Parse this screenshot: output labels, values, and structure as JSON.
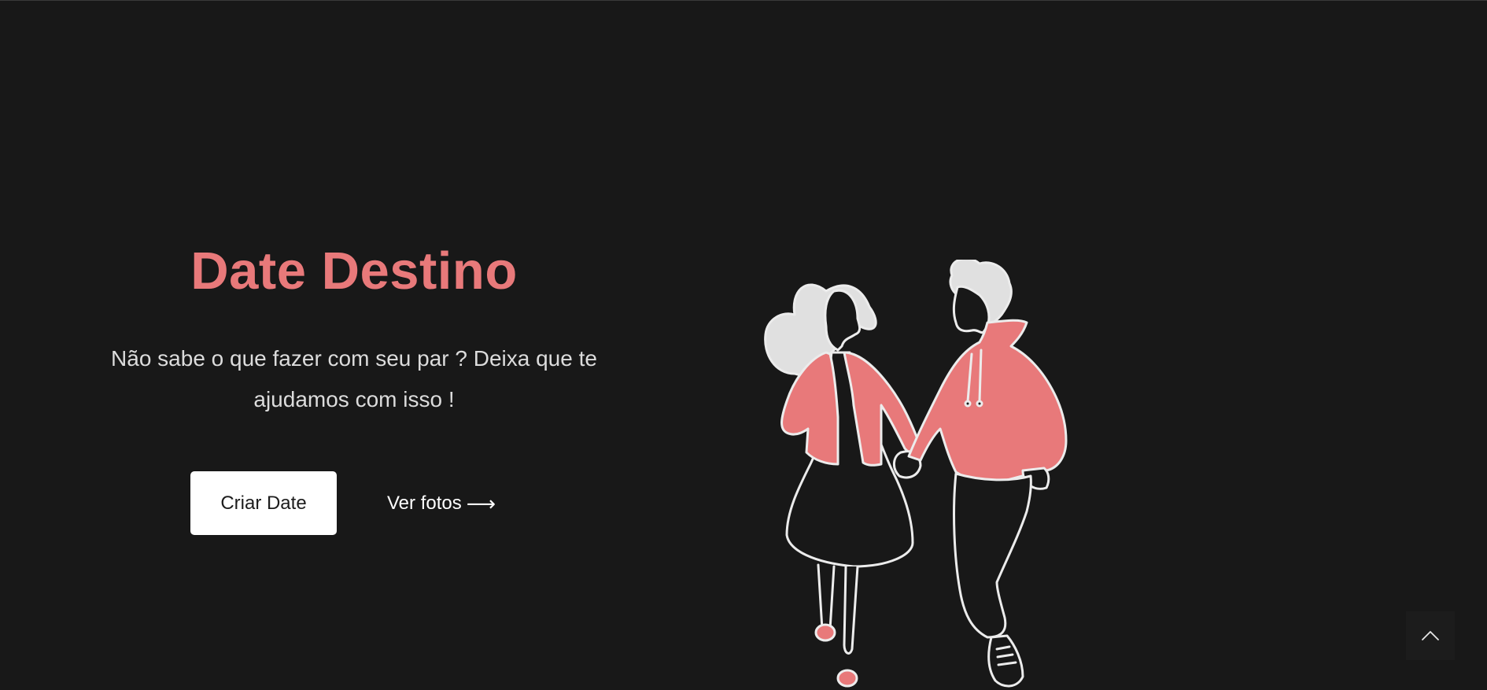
{
  "hero": {
    "title": "Date Destino",
    "subtitle_line1": "Não sabe o que fazer com seu par ? Deixa que te",
    "subtitle_line2": "ajudamos com isso !",
    "primary_button_label": "Criar Date",
    "secondary_link_label": "Ver fotos",
    "secondary_link_arrow": "⟶"
  },
  "illustration": {
    "name": "couple-walking-illustration"
  },
  "back_to_top": {
    "icon": "chevron-up-icon"
  },
  "colors": {
    "background": "#181818",
    "accent": "#E8797A",
    "text_muted": "#dcdcdc",
    "button_bg": "#ffffff"
  }
}
